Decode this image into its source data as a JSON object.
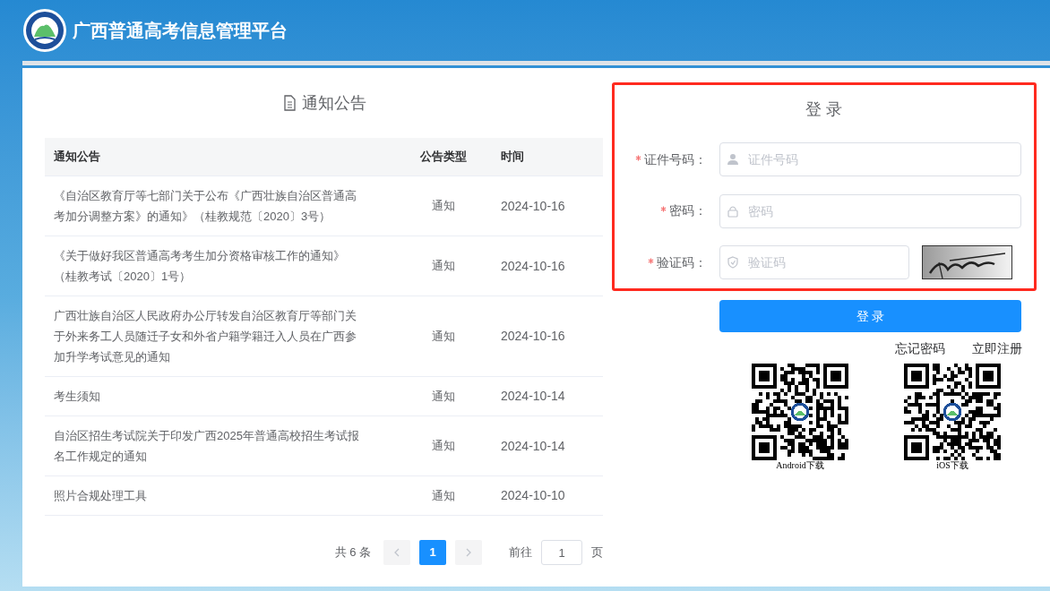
{
  "header": {
    "title": "广西普通高考信息管理平台"
  },
  "notices": {
    "title": "通知公告",
    "columns": [
      "通知公告",
      "公告类型",
      "时间"
    ],
    "rows": [
      {
        "title": "《自治区教育厅等七部门关于公布《广西壮族自治区普通高考加分调整方案》的通知》（桂教规范〔2020〕3号）",
        "type": "通知",
        "date": "2024-10-16"
      },
      {
        "title": "《关于做好我区普通高考考生加分资格审核工作的通知》（桂教考试〔2020〕1号）",
        "type": "通知",
        "date": "2024-10-16"
      },
      {
        "title": "广西壮族自治区人民政府办公厅转发自治区教育厅等部门关于外来务工人员随迁子女和外省户籍学籍迁入人员在广西参加升学考试意见的通知",
        "type": "通知",
        "date": "2024-10-16"
      },
      {
        "title": "考生须知",
        "type": "通知",
        "date": "2024-10-14"
      },
      {
        "title": "自治区招生考试院关于印发广西2025年普通高校招生考试报名工作规定的通知",
        "type": "通知",
        "date": "2024-10-14"
      },
      {
        "title": "照片合规处理工具",
        "type": "通知",
        "date": "2024-10-10"
      }
    ],
    "pagination": {
      "total": "共 6 条",
      "pages": [
        {
          "label": "1",
          "selected": true
        }
      ],
      "goto_label": "前往",
      "goto_value": "1",
      "page_suffix": "页"
    }
  },
  "login": {
    "title": "登 录",
    "fields": [
      {
        "kind": "user",
        "label": "证件号码：",
        "placeholder": "证件号码",
        "required": true
      },
      {
        "kind": "lock",
        "label": "密码：",
        "placeholder": "密码",
        "required": true
      },
      {
        "kind": "captcha",
        "label": "验证码：",
        "placeholder": "验证码",
        "required": true
      }
    ],
    "button": "登 录",
    "links": [
      "忘记密码",
      "立即注册"
    ],
    "downloads": [
      {
        "label": "Android下载"
      },
      {
        "label": "iOS下载"
      }
    ]
  }
}
